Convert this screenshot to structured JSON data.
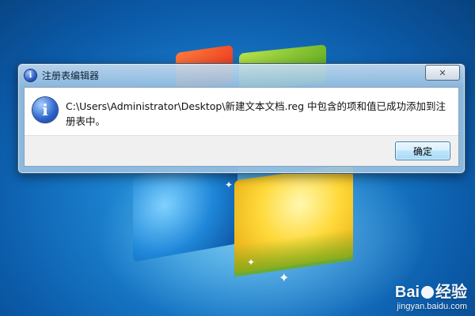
{
  "dialog": {
    "title": "注册表编辑器",
    "message": "C:\\Users\\Administrator\\Desktop\\新建文本文档.reg 中包含的项和值已成功添加到注册表中。",
    "ok_label": "确定",
    "close_label": "✕",
    "title_icon": "info-icon",
    "message_icon": "info-icon"
  },
  "watermark": {
    "logo_pre": "Bai",
    "logo_post": "经验",
    "site": "jingyan.baidu.com"
  },
  "colors": {
    "desktop": "#1a7fcd",
    "ok_button_border": "#3c7fb1",
    "dialog_frame": "#96c0e1"
  }
}
